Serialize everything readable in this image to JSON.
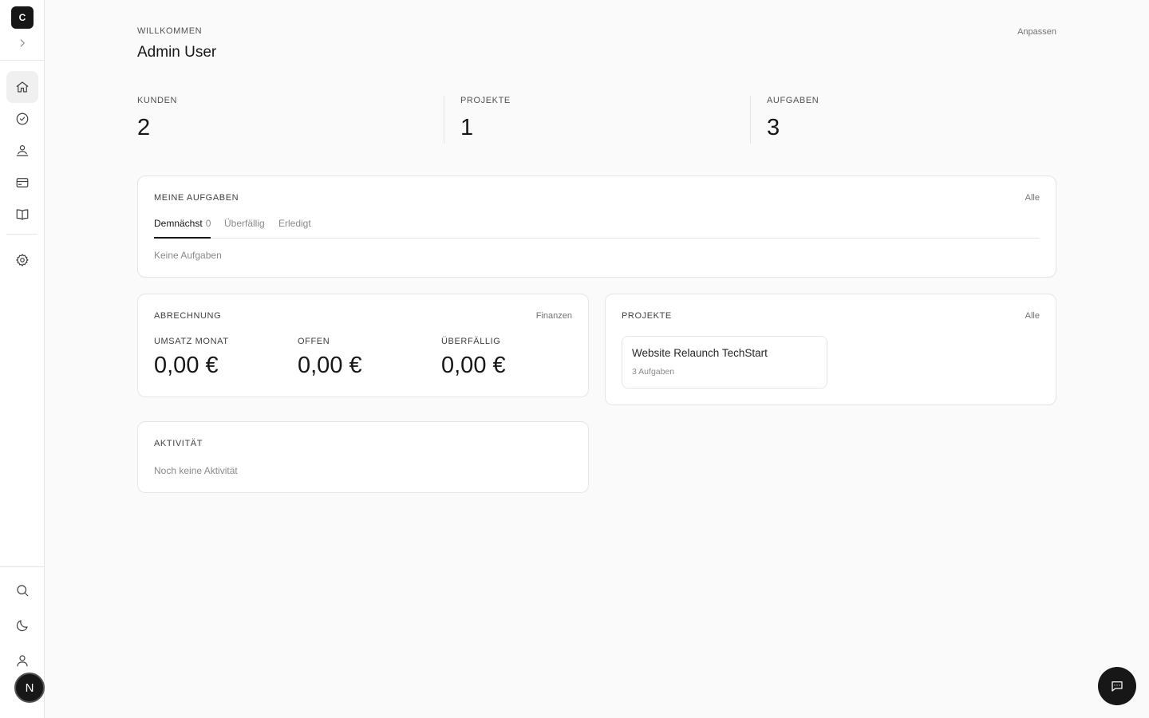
{
  "sidebar": {
    "logo_letter": "C",
    "nav": [
      {
        "name": "home-icon"
      },
      {
        "name": "check-circle-icon"
      },
      {
        "name": "users-icon"
      },
      {
        "name": "credit-card-icon"
      },
      {
        "name": "book-icon"
      },
      {
        "name": "gear-icon"
      }
    ],
    "bottom": [
      {
        "name": "search-icon"
      },
      {
        "name": "moon-icon"
      },
      {
        "name": "user-icon"
      }
    ],
    "avatar_letter": "N"
  },
  "header": {
    "eyebrow": "WILLKOMMEN",
    "user_name": "Admin User",
    "customize_label": "Anpassen"
  },
  "stats": [
    {
      "label": "KUNDEN",
      "value": "2"
    },
    {
      "label": "PROJEKTE",
      "value": "1"
    },
    {
      "label": "AUFGABEN",
      "value": "3"
    }
  ],
  "tasks": {
    "title": "MEINE AUFGABEN",
    "link": "Alle",
    "tabs": [
      {
        "label": "Demnächst",
        "count": "0",
        "active": true
      },
      {
        "label": "Überfällig"
      },
      {
        "label": "Erledigt"
      }
    ],
    "empty": "Keine Aufgaben"
  },
  "billing": {
    "title": "ABRECHNUNG",
    "link": "Finanzen",
    "metrics": [
      {
        "label": "UMSATZ MONAT",
        "value": "0,00 €"
      },
      {
        "label": "OFFEN",
        "value": "0,00 €"
      },
      {
        "label": "ÜBERFÄLLIG",
        "value": "0,00 €"
      }
    ]
  },
  "projects": {
    "title": "PROJEKTE",
    "link": "Alle",
    "items": [
      {
        "name": "Website Relaunch TechStart",
        "meta": "3 Aufgaben"
      }
    ]
  },
  "activity": {
    "title": "AKTIVITÄT",
    "empty": "Noch keine Aktivität"
  },
  "colors": {
    "background": "#fafafa",
    "accent": "#171717",
    "border": "#e5e5e5"
  }
}
